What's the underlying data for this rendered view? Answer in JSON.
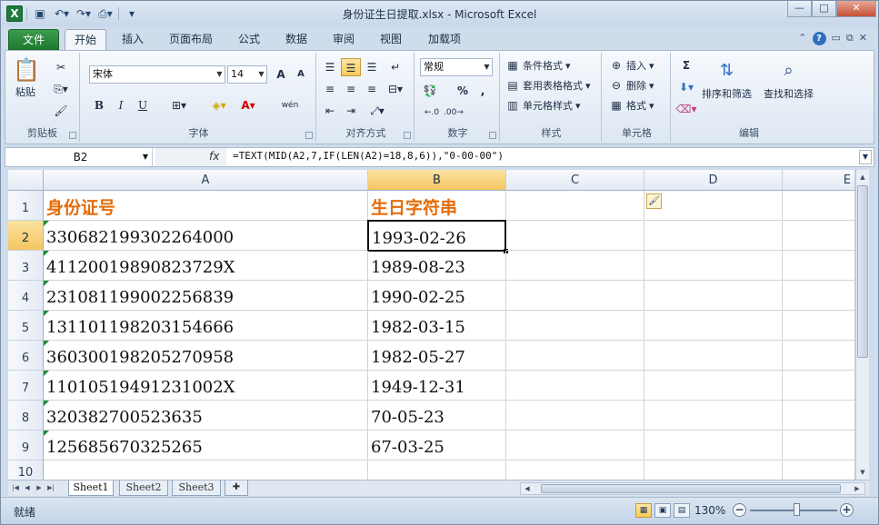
{
  "window": {
    "title": "身份证生日提取.xlsx - Microsoft Excel",
    "logo": "X",
    "controls": {
      "minimize": "—",
      "maximize": "□",
      "close": "✕"
    }
  },
  "qat": {
    "save_icon": "save-icon",
    "undo_icon": "undo-icon",
    "redo_icon": "redo-icon",
    "preview_icon": "print-preview-icon"
  },
  "tabs": [
    {
      "label": "文件"
    },
    {
      "label": "开始"
    },
    {
      "label": "插入"
    },
    {
      "label": "页面布局"
    },
    {
      "label": "公式"
    },
    {
      "label": "数据"
    },
    {
      "label": "审阅"
    },
    {
      "label": "视图"
    },
    {
      "label": "加载项"
    }
  ],
  "ribbon": {
    "clipboard": {
      "label": "剪贴板",
      "paste": "粘贴"
    },
    "font": {
      "label": "字体",
      "name": "宋体",
      "size": "14",
      "grow": "A",
      "shrink": "A",
      "bold": "B",
      "italic": "I",
      "underline": "U",
      "phonetic": "wén"
    },
    "alignment": {
      "label": "对齐方式"
    },
    "number": {
      "label": "数字",
      "format": "常规",
      "percent": "%",
      "comma": ","
    },
    "styles": {
      "label": "样式",
      "conditional": "条件格式",
      "table": "套用表格格式",
      "cell": "单元格样式"
    },
    "cells": {
      "label": "单元格",
      "insert": "插入",
      "delete": "删除",
      "format": "格式"
    },
    "editing": {
      "label": "编辑",
      "sort": "排序和筛选",
      "find": "查找和选择",
      "sum": "Σ"
    }
  },
  "formula_bar": {
    "name_box": "B2",
    "fx": "fx",
    "formula": "=TEXT(MID(A2,7,IF(LEN(A2)=18,8,6)),\"0-00-00\")"
  },
  "columns": [
    "A",
    "B",
    "C",
    "D",
    "E"
  ],
  "rows": [
    "1",
    "2",
    "3",
    "4",
    "5",
    "6",
    "7",
    "8",
    "9",
    "10"
  ],
  "cells": {
    "A1": "身份证号",
    "B1": "生日字符串",
    "A2": "330682199302264000",
    "B2": "1993-02-26",
    "A3": "41120019890823729X",
    "B3": "1989-08-23",
    "A4": "231081199002256839",
    "B4": "1990-02-25",
    "A5": "131101198203154666",
    "B5": "1982-03-15",
    "A6": "360300198205270958",
    "B6": "1982-05-27",
    "A7": "11010519491231002X",
    "B7": "1949-12-31",
    "A8": "320382700523635",
    "B8": "70-05-23",
    "A9": "125685670325265",
    "B9": "67-03-25"
  },
  "sheets": [
    "Sheet1",
    "Sheet2",
    "Sheet3"
  ],
  "status": {
    "ready": "就绪",
    "zoom": "130%"
  }
}
